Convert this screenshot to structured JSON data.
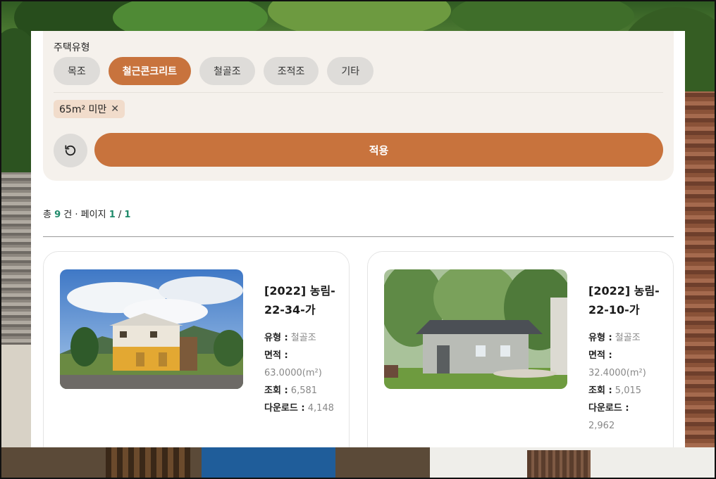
{
  "filter": {
    "title": "주택유형",
    "chips": [
      {
        "label": "목조",
        "active": false
      },
      {
        "label": "철근콘크리트",
        "active": true
      },
      {
        "label": "철골조",
        "active": false
      },
      {
        "label": "조적조",
        "active": false
      },
      {
        "label": "기타",
        "active": false
      }
    ],
    "selected_tag": "65m² 미만",
    "tag_remove_icon": "close-icon",
    "reset_icon": "refresh-icon",
    "apply_label": "적용"
  },
  "summary": {
    "prefix": "총",
    "total": "9",
    "unit": "건 · 페이지",
    "page_current": "1",
    "slash": "/",
    "page_total": "1"
  },
  "items": [
    {
      "title": "[2022] 농림-22-34-가",
      "type_label": "유형 :",
      "type_value": "철골조",
      "area_label": "면적 :",
      "area_value": "63.0000(m²)",
      "views_label": "조회 :",
      "views_value": "6,581",
      "downloads_label": "다운로드 :",
      "downloads_value": "4,148"
    },
    {
      "title": "[2022] 농림-22-10-가",
      "type_label": "유형 :",
      "type_value": "철골조",
      "area_label": "면적 :",
      "area_value": "32.4000(m²)",
      "views_label": "조회 :",
      "views_value": "5,015",
      "downloads_label": "다운로드 :",
      "downloads_value": "2,962"
    }
  ],
  "colors": {
    "accent": "#c8733d",
    "count_green": "#1f8a6a",
    "panel_bg": "#f5f1ec",
    "chip_bg": "#dedcd9"
  }
}
